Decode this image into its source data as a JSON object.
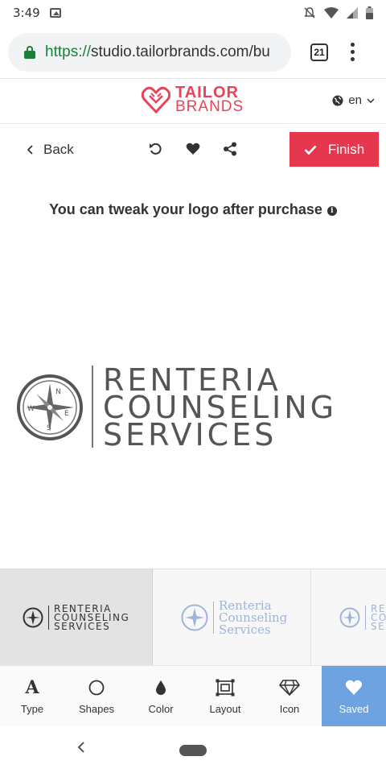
{
  "status_bar": {
    "time": "3:49"
  },
  "browser": {
    "url_scheme": "https://",
    "url_host": "studio.tailorbrands.com/bu",
    "tab_count": "21"
  },
  "brand": {
    "name": "TAILOR",
    "sub": "BRANDS",
    "language": "en"
  },
  "toolbar": {
    "back_label": "Back",
    "finish_label": "Finish"
  },
  "notice": {
    "text": "You can tweak your logo after purchase"
  },
  "logo": {
    "lines": [
      "RENTERIA",
      "COUNSELING",
      "SERVICES"
    ],
    "compass_letters": [
      "N",
      "E",
      "S",
      "W"
    ]
  },
  "variants": [
    {
      "lines": [
        "RENTERIA",
        "COUNSELING",
        "SERVICES"
      ],
      "color": "#333333"
    },
    {
      "lines": [
        "Renteria",
        "Counseling",
        "Services"
      ],
      "color": "#9fb4d8"
    },
    {
      "lines": [
        "REN",
        "COU",
        "SER"
      ],
      "color": "#9fb4d8"
    }
  ],
  "tools": [
    {
      "label": "Type",
      "icon": "type-icon"
    },
    {
      "label": "Shapes",
      "icon": "circle-icon"
    },
    {
      "label": "Color",
      "icon": "droplet-icon"
    },
    {
      "label": "Layout",
      "icon": "layout-icon"
    },
    {
      "label": "Icon",
      "icon": "diamond-icon"
    },
    {
      "label": "Saved",
      "icon": "heart-icon"
    }
  ],
  "colors": {
    "accent": "#e5384f",
    "brand": "#e8435a",
    "saved": "#6ca3e0",
    "secure": "#188038"
  }
}
